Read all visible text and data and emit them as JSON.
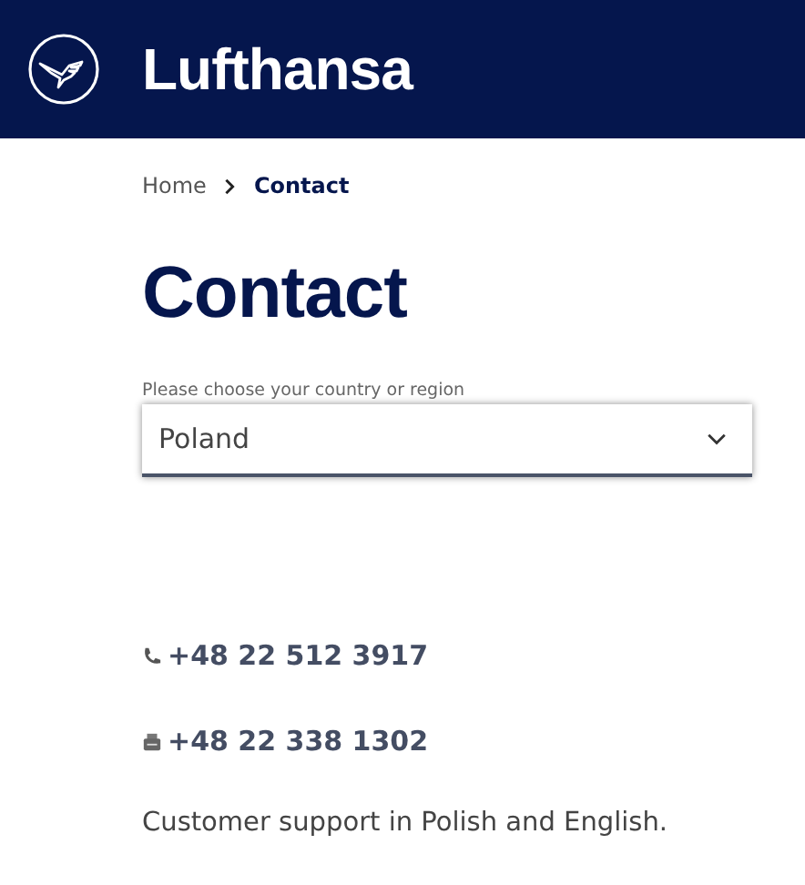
{
  "header": {
    "brand": "Lufthansa"
  },
  "breadcrumb": [
    {
      "label": "Home",
      "current": false
    },
    {
      "label": "Contact",
      "current": true
    }
  ],
  "title": "Contact",
  "country_select": {
    "label": "Please choose your country or region",
    "value": "Poland"
  },
  "contacts": [
    {
      "kind": "phone",
      "number": "+48 22 512 3917"
    },
    {
      "kind": "fax",
      "number": "+48 22 338 1302"
    }
  ],
  "note": "Customer support in Polish and English."
}
